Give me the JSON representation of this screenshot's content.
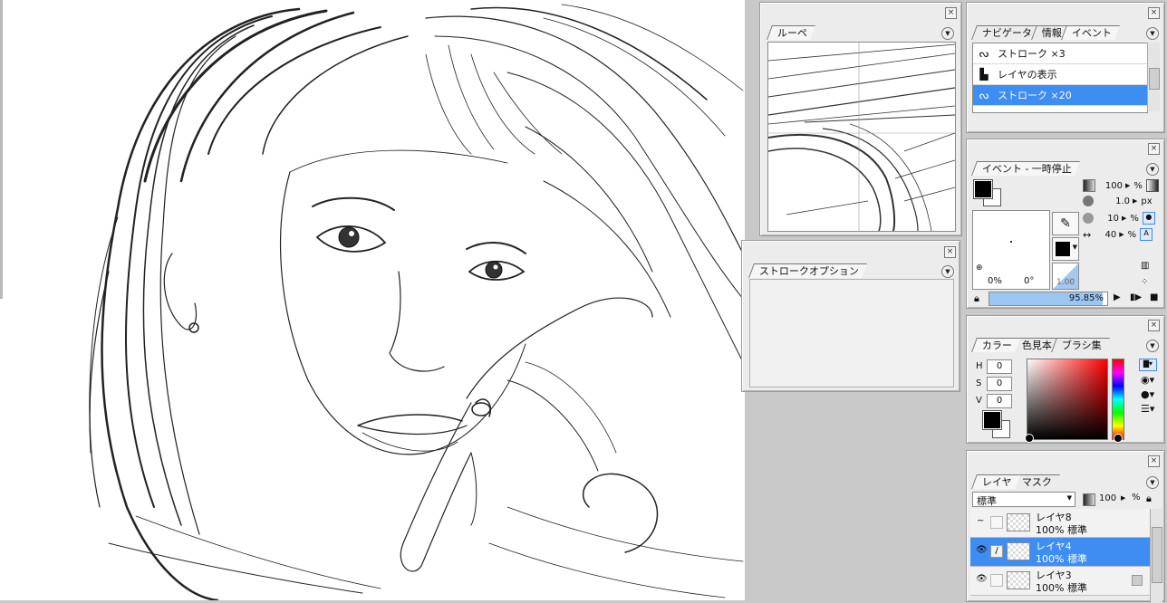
{
  "panels": {
    "loupe": {
      "tab": "ルーペ"
    },
    "stroke_options": {
      "tab": "ストロークオプション"
    },
    "history": {
      "tabs": [
        "ナビゲータ",
        "情報",
        "イベント"
      ],
      "items": [
        {
          "label": "ストローク ×3",
          "icon": "stroke-icon",
          "selected": false
        },
        {
          "label": "レイヤの表示",
          "icon": "layer-visibility-icon",
          "selected": false
        },
        {
          "label": "ストローク ×20",
          "icon": "stroke-icon",
          "selected": true
        }
      ]
    },
    "action": {
      "tab": "イベント - 一時停止",
      "opacity": "100",
      "opacity_unit": "%",
      "size": "1.0",
      "size_unit": "px",
      "density": "10",
      "density_unit": "%",
      "spacing": "40",
      "spacing_unit": "%",
      "percent_a": "0%",
      "angle": "0°",
      "ratio": "1.00",
      "progress_text": "95.85%",
      "progress": 0.9585
    },
    "color": {
      "tabs": [
        "カラー",
        "色見本",
        "ブラシ集"
      ],
      "h_label": "H",
      "h": "0",
      "s_label": "S",
      "s": "0",
      "v_label": "V",
      "v": "0"
    },
    "layers": {
      "tabs": [
        "レイヤ",
        "マスク"
      ],
      "blend_mode": "標準",
      "opacity": "100",
      "items": [
        {
          "name": "レイヤ8",
          "mode": "100% 標準",
          "selected": false
        },
        {
          "name": "レイヤ4",
          "mode": "100% 標準",
          "selected": true
        },
        {
          "name": "レイヤ3",
          "mode": "100% 標準",
          "selected": false
        }
      ]
    }
  },
  "colors": {
    "selection": "#3d8df2",
    "panel_bg": "#ececec",
    "workspace": "#c9c9c9"
  }
}
